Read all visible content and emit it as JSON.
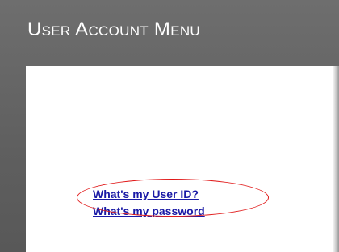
{
  "header": {
    "title": "User Account Menu"
  },
  "links": {
    "user_id": "What's my User ID?",
    "password": "What's my password"
  },
  "colors": {
    "header_bg": "#6e6e6e",
    "link": "#1a1aa6",
    "annotation": "#e01818"
  }
}
